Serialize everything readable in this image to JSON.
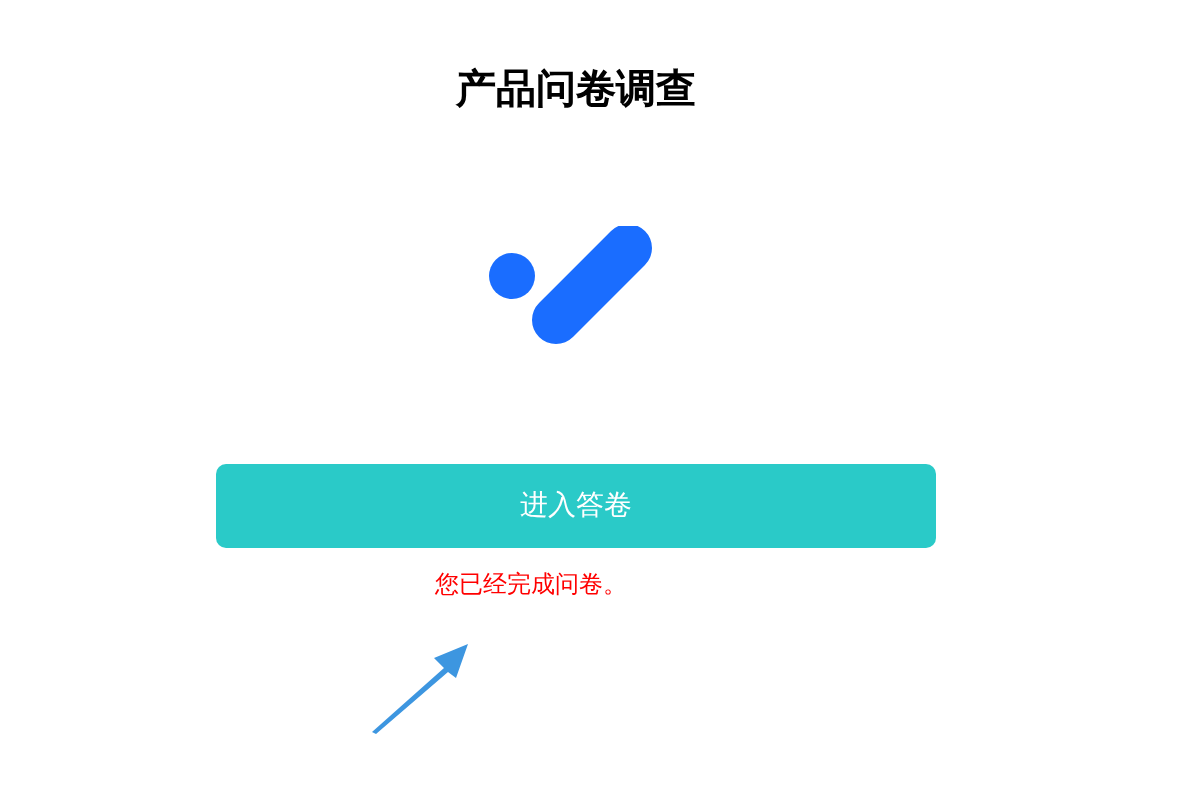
{
  "title": "产品问卷调查",
  "enter_button": {
    "label": "进入答卷"
  },
  "message": "您已经完成问卷。"
}
